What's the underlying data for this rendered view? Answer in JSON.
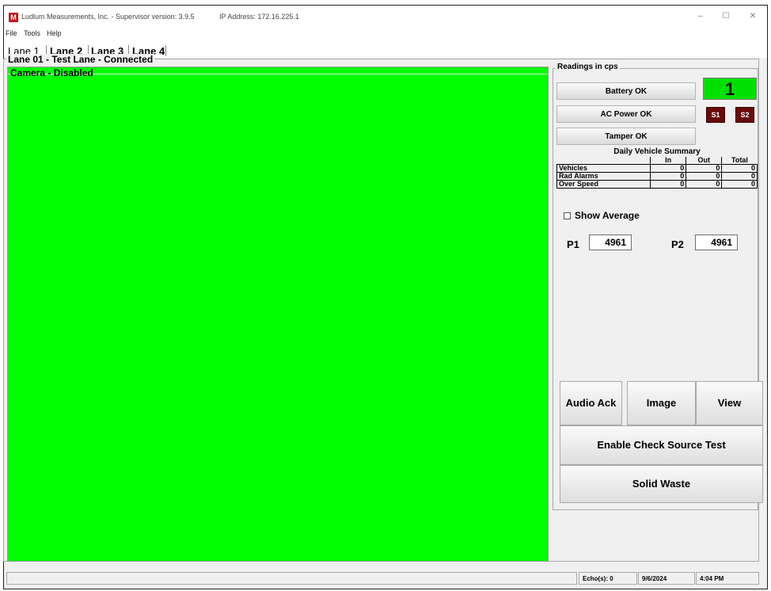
{
  "window": {
    "title": "Ludlum Measurements, Inc. - Supervisor   version: 3.9.5",
    "ip": "IP Address:  172.16.225.1",
    "icon": "ludlum-logo-icon"
  },
  "menu": [
    "File",
    "Tools",
    "Help"
  ],
  "tabs": [
    "Lane 1",
    "Lane 2",
    "Lane 3",
    "Lane 4"
  ],
  "lane": {
    "group_title": "Lane 01 - Test Lane - Connected",
    "camera_title": "Camera - Disabled",
    "camera_color": "#00ff00"
  },
  "readings": {
    "title": "Readings in cps",
    "battery": "Battery OK",
    "ac_power": "AC Power OK",
    "tamper": "Tamper OK",
    "lane_number": "1",
    "s1": "S1",
    "s2": "S2"
  },
  "summary": {
    "title": "Daily Vehicle Summary",
    "columns": [
      "In",
      "Out",
      "Total"
    ],
    "rows": [
      {
        "label": "Vehicles",
        "in": "0",
        "out": "0",
        "total": "0"
      },
      {
        "label": "Rad Alarms",
        "in": "0",
        "out": "0",
        "total": "0"
      },
      {
        "label": "Over Speed",
        "in": "0",
        "out": "0",
        "total": "0"
      }
    ]
  },
  "show_average": {
    "label": "Show Average",
    "checked": false
  },
  "p1": {
    "label": "P1",
    "value": "4961"
  },
  "p2": {
    "label": "P2",
    "value": "4961"
  },
  "buttons": {
    "audio_ack": "Audio Ack",
    "image": "Image",
    "view": "View",
    "check_source": "Enable Check Source Test",
    "solid_waste": "Solid Waste"
  },
  "status": {
    "echo": "Echo(s): 0",
    "date": "9/6/2024",
    "time": "4:04 PM"
  },
  "colors": {
    "lane_indicator": "#00e000",
    "s_button": "#6b0a0a",
    "logo": "#c4161c"
  }
}
